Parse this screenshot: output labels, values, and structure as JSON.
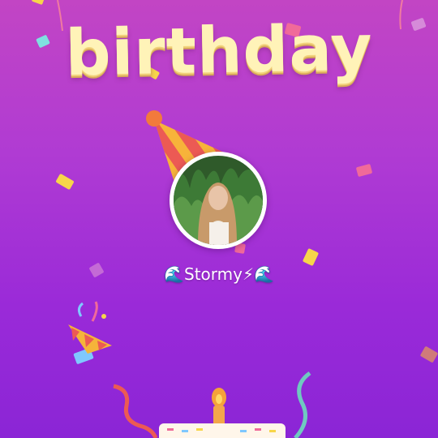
{
  "title": "birthday",
  "profile": {
    "display_name": "🌊Stormy⚡🌊"
  },
  "icons": {
    "party_hat": "party-hat-icon",
    "party_popper": "party-popper-icon",
    "cake": "birthday-cake-icon",
    "avatar": "profile-avatar"
  },
  "colors": {
    "background_top": "#c245c4",
    "background_bottom": "#8b25d6",
    "title_fill": "#fff3b8",
    "confetti_yellow": "#f7d64a",
    "confetti_pink": "#f06a9a",
    "confetti_blue": "#7fc8ff"
  }
}
